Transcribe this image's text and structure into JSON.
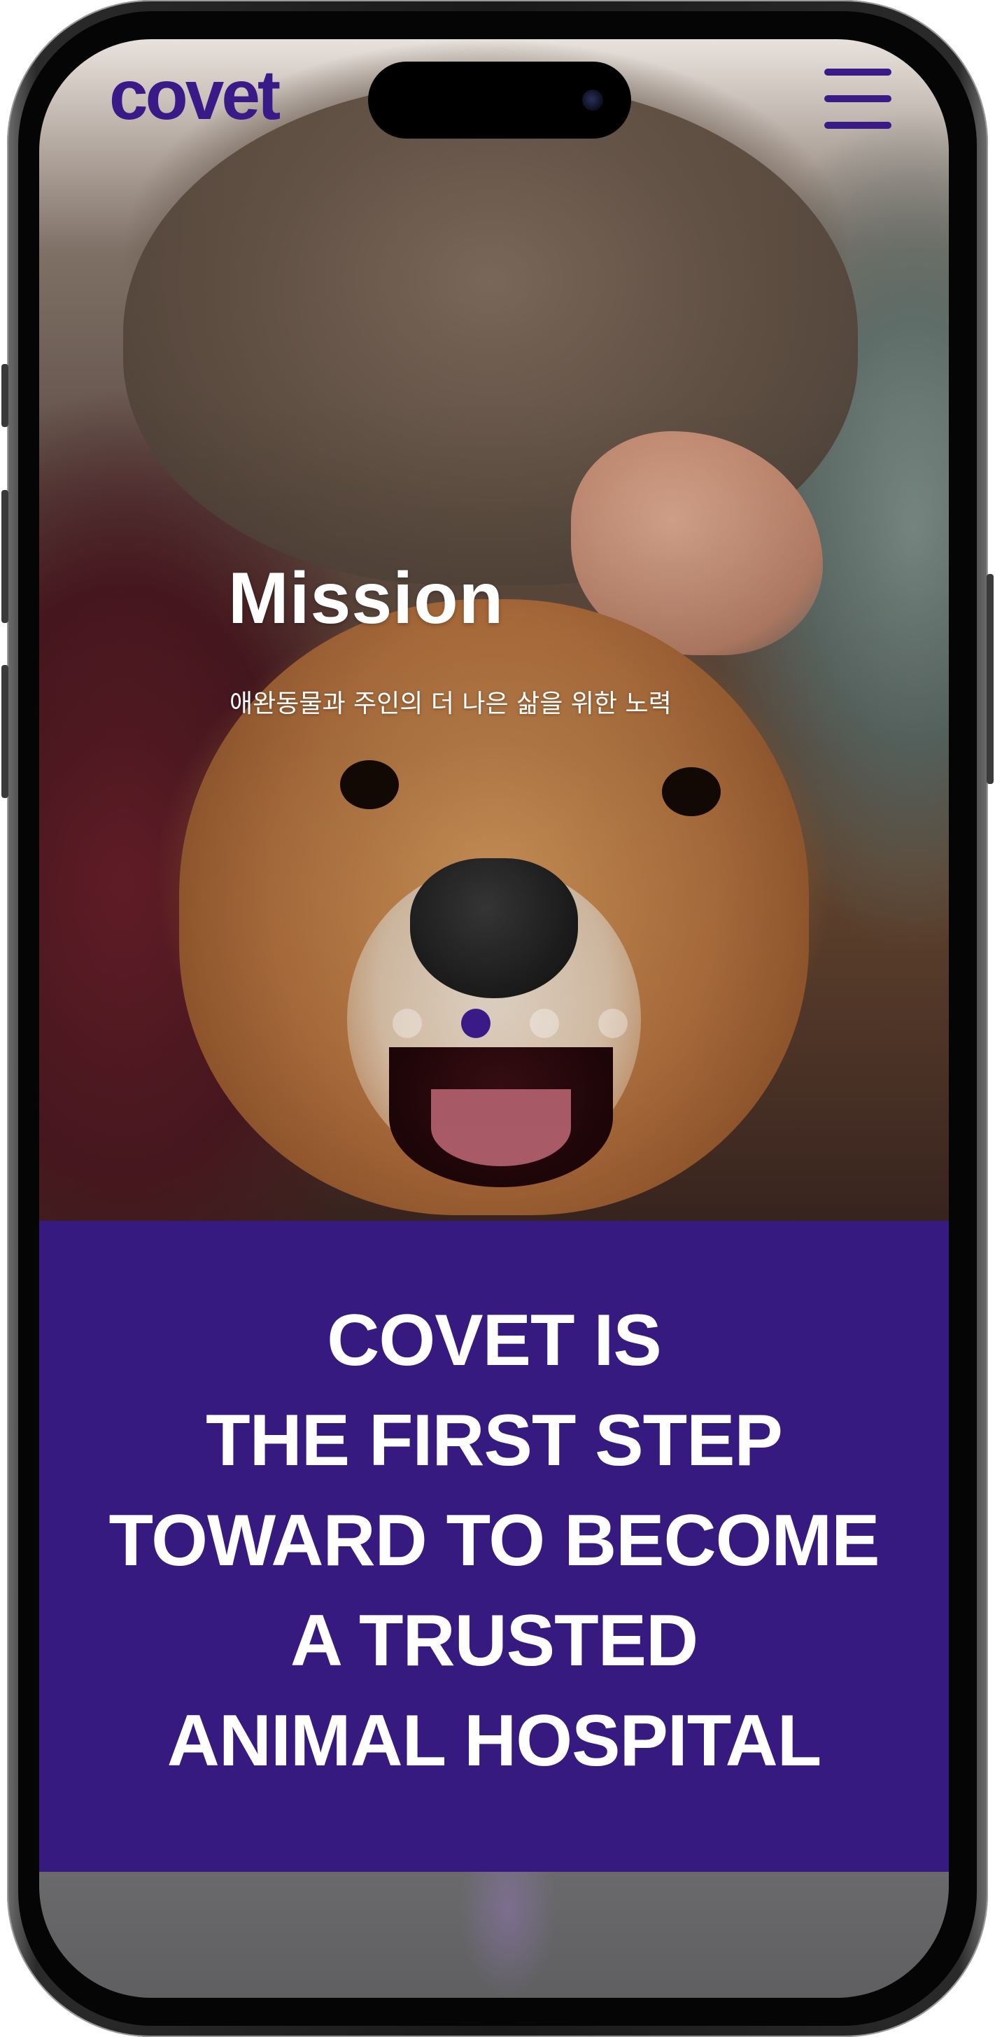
{
  "header": {
    "logo_text": "covet",
    "menu_icon": "hamburger-menu-icon"
  },
  "hero": {
    "title": "Mission",
    "subtitle": "애완동물과 주인의 더 나은 삶을 위한 노력",
    "carousel": {
      "total_slides": 4,
      "active_index": 1
    }
  },
  "statement": {
    "lines": [
      "COVET IS",
      "THE FIRST STEP",
      "TOWARD TO BECOME",
      "A TRUSTED",
      "ANIMAL HOSPITAL"
    ]
  },
  "colors": {
    "brand_purple": "#371a80",
    "logo_purple": "#3a1a86",
    "text_light": "#ffffff"
  }
}
